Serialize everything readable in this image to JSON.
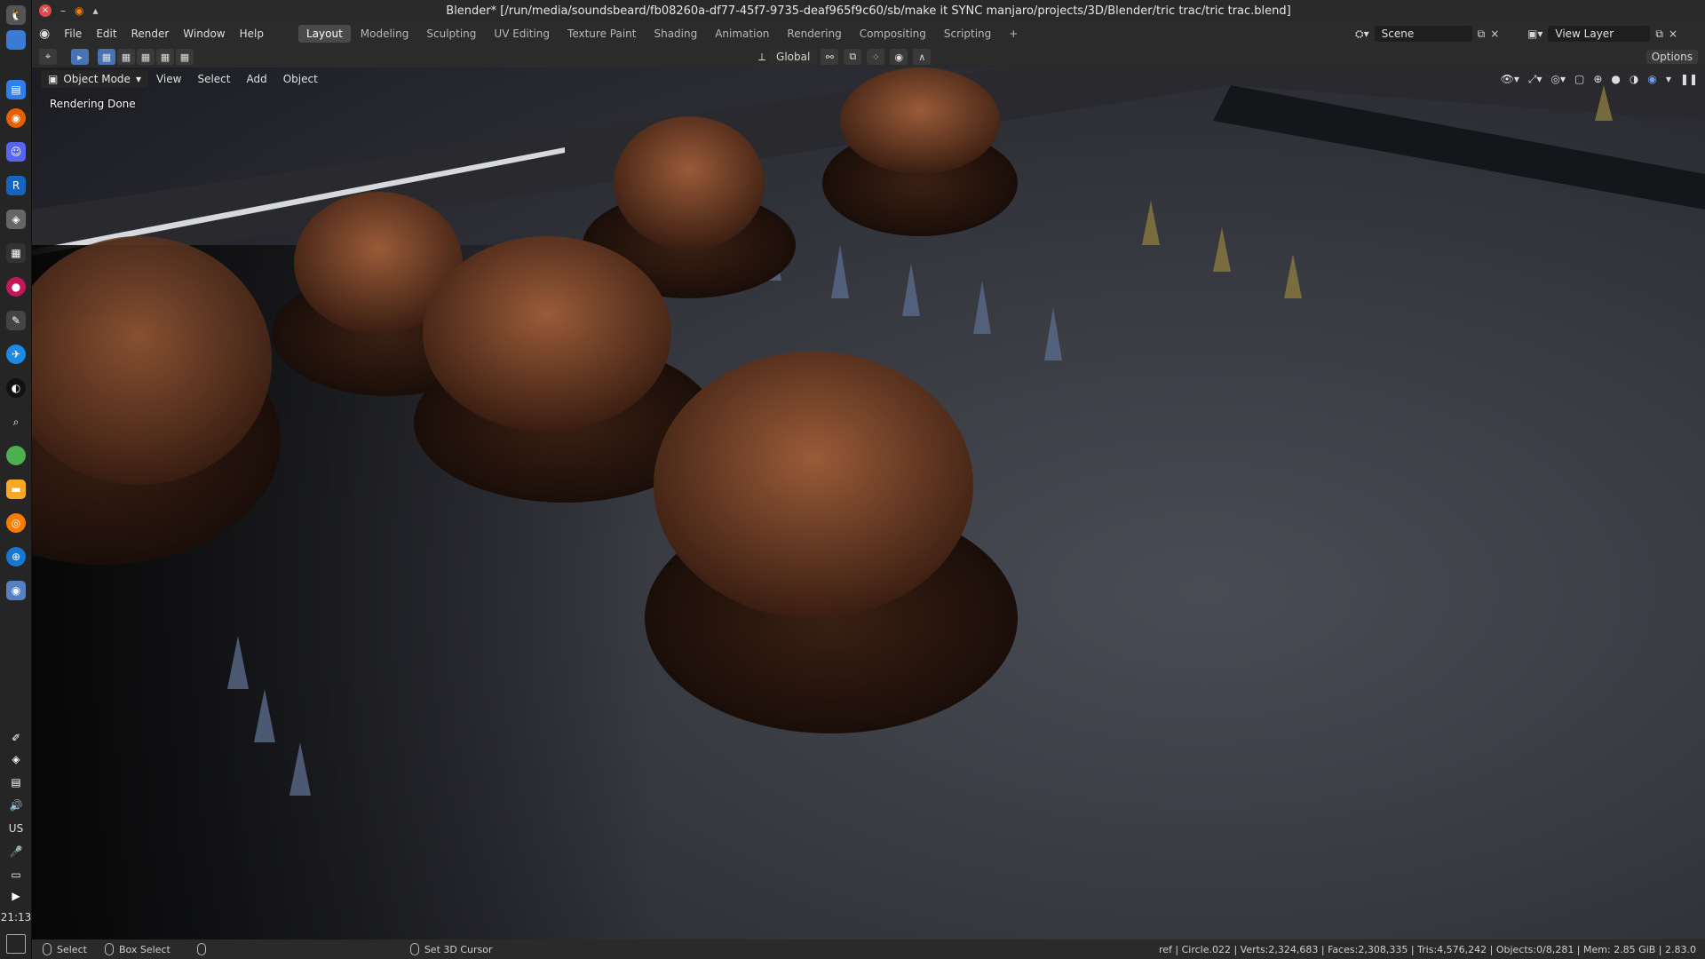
{
  "window": {
    "title": "Blender* [/run/media/soundsbeard/fb08260a-df77-45f7-9735-deaf965f9c60/sb/make it SYNC manjaro/projects/3D/Blender/tric trac/tric trac.blend]"
  },
  "menus": [
    "File",
    "Edit",
    "Render",
    "Window",
    "Help"
  ],
  "workspaces": [
    "Layout",
    "Modeling",
    "Sculpting",
    "UV Editing",
    "Texture Paint",
    "Shading",
    "Animation",
    "Rendering",
    "Compositing",
    "Scripting"
  ],
  "active_workspace": "Layout",
  "scene": {
    "label": "Scene",
    "view_layer": "View Layer"
  },
  "toolbar": {
    "orientation": "Global",
    "options": "Options"
  },
  "viewport": {
    "mode": "Object Mode",
    "menus": [
      "View",
      "Select",
      "Add",
      "Object"
    ],
    "status": "Rendering Done"
  },
  "dock": {
    "lang": "US",
    "clock": "21:13"
  },
  "statusbar": {
    "select": "Select",
    "box_select": "Box Select",
    "cursor": "Set 3D Cursor",
    "stats": "ref | Circle.022 | Verts:2,324,683 | Faces:2,308,335 | Tris:4,576,242 | Objects:0/8,281 | Mem: 2.85 GiB | 2.83.0"
  },
  "colors": {
    "accent": "#4772b3",
    "close": "#e04a4a"
  }
}
